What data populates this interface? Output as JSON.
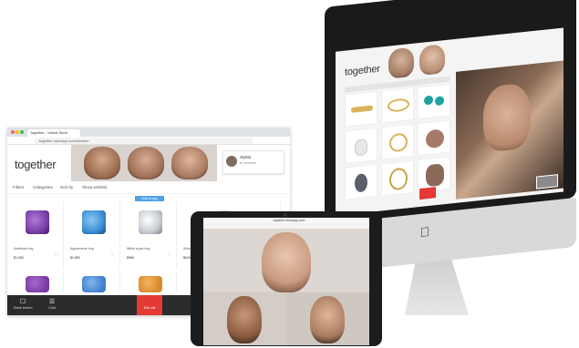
{
  "imac": {
    "brand": "together",
    "apple_logo": "apple-icon"
  },
  "browser": {
    "tab_title": "Together - Virtual Store",
    "url": "together.storeapp.com/session",
    "brand": "together",
    "call_card": {
      "name": "Stylist",
      "status": "In session"
    },
    "filters": [
      "Filters",
      "Categories",
      "Sort by",
      "Show wishlist"
    ],
    "add_button": "Add to bag",
    "products": [
      {
        "name": "Amethyst ring",
        "price": "$1,250",
        "color": "#7b3fa8"
      },
      {
        "name": "Aquamarine ring",
        "price": "$1,890",
        "color": "#3a8fd6"
      },
      {
        "name": "White topaz ring",
        "price": "$980",
        "color": "#c8ccd2"
      },
      {
        "name": "Silver band",
        "price": "$640",
        "color": "#9a9a9a"
      }
    ],
    "products_row2": [
      {
        "color": "#7a3aa0"
      },
      {
        "color": "#3f7fd0"
      },
      {
        "color": "#d98a2a"
      }
    ],
    "bottom_bar": {
      "item_1": "Share screen",
      "item_2": "Chat",
      "end": "End call"
    }
  },
  "ipad": {
    "url": "together.storeapp.com"
  },
  "colors": {
    "accent_red": "#e53935",
    "accent_blue": "#4da3e8",
    "brand_text": "#333333"
  }
}
